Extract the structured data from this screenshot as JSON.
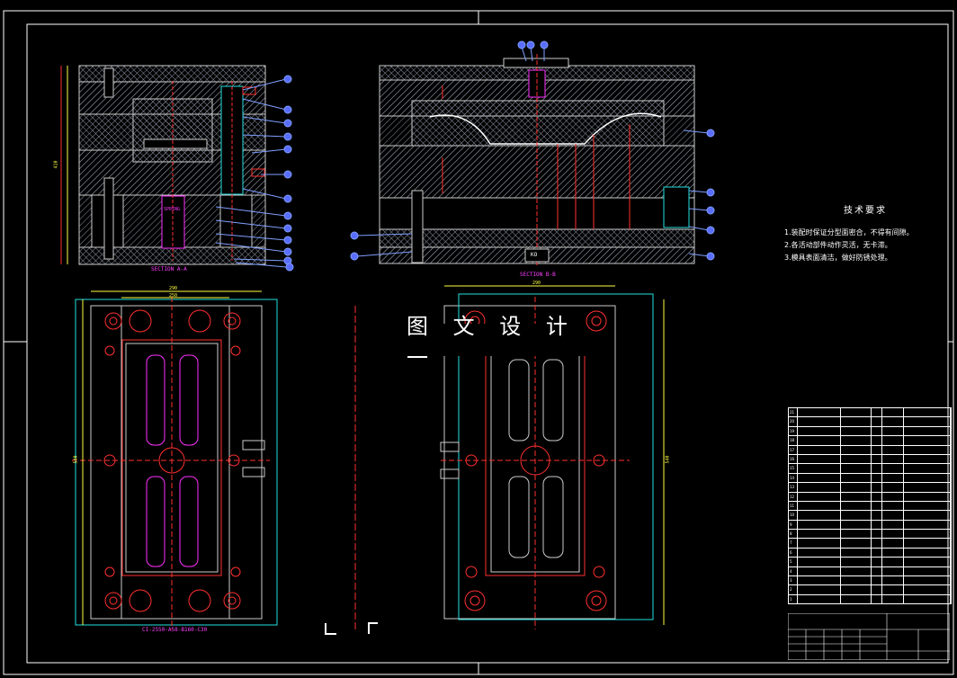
{
  "drawing": {
    "section_a": "SECTION A-A",
    "section_b": "SECTION B-B",
    "watermark": "图 文 设 计 一",
    "bottom_view_label": "CI-2550-A58-B160-C30",
    "dim_top_left_1": "290",
    "dim_top_left_2": "250",
    "dim_top_right": "290",
    "dim_side_left": "540",
    "dim_side_right": "540",
    "dim_height_a": "410",
    "spring_label": "SPRING",
    "part_ko": "KO"
  },
  "tech_requirements": {
    "title": "技术要求",
    "lines": [
      "1.装配时保证分型面密合，不得有间隙。",
      "2.各活动部件动作灵活，无卡滞。",
      "3.模具表面清洁，做好防锈处理。"
    ]
  },
  "bom": {
    "rows": [
      [
        "21",
        "",
        "",
        "",
        "",
        ""
      ],
      [
        "20",
        "",
        "",
        "",
        "",
        ""
      ],
      [
        "19",
        "",
        "",
        "",
        "",
        ""
      ],
      [
        "18",
        "",
        "",
        "",
        "",
        ""
      ],
      [
        "17",
        "",
        "",
        "",
        "",
        ""
      ],
      [
        "16",
        "",
        "",
        "",
        "",
        ""
      ],
      [
        "15",
        "",
        "",
        "",
        "",
        ""
      ],
      [
        "14",
        "",
        "",
        "",
        "",
        ""
      ],
      [
        "13",
        "",
        "",
        "",
        "",
        ""
      ],
      [
        "12",
        "",
        "",
        "",
        "",
        ""
      ],
      [
        "11",
        "",
        "",
        "",
        "",
        ""
      ],
      [
        "10",
        "",
        "",
        "",
        "",
        ""
      ],
      [
        "9",
        "",
        "",
        "",
        "",
        ""
      ],
      [
        "8",
        "",
        "",
        "",
        "",
        ""
      ],
      [
        "7",
        "",
        "",
        "",
        "",
        ""
      ],
      [
        "6",
        "",
        "",
        "",
        "",
        ""
      ],
      [
        "5",
        "",
        "",
        "",
        "",
        ""
      ],
      [
        "4",
        "",
        "",
        "",
        "",
        ""
      ],
      [
        "3",
        "",
        "",
        "",
        "",
        ""
      ],
      [
        "2",
        "",
        "",
        "",
        "",
        ""
      ],
      [
        "1",
        "",
        "",
        "",
        "",
        ""
      ]
    ]
  },
  "title_block": {
    "name": "",
    "subtitle": ""
  },
  "colors": {
    "frame": "#ffffff",
    "hatch": "#9aa3b5",
    "plate": "#c8c8c8",
    "leader": "#7f9fff",
    "balloon": "#5a6dff",
    "cyan": "#22e0e0",
    "magenta": "#ff30ff",
    "red": "#ff3030",
    "yellow": "#ffff40",
    "green": "#30ff30"
  }
}
